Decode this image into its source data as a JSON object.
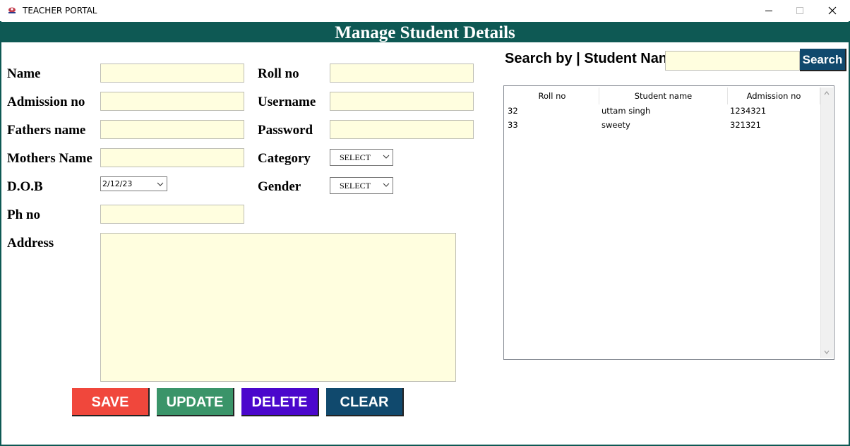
{
  "window": {
    "title": "TEACHER PORTAL"
  },
  "header": {
    "title": "Manage Student Details"
  },
  "form": {
    "name_label": "Name",
    "admission_label": "Admission no",
    "fathers_label": "Fathers name",
    "mothers_label": "Mothers Name",
    "dob_label": "D.O.B",
    "phone_label": "Ph no",
    "address_label": "Address",
    "roll_label": "Roll no",
    "username_label": "Username",
    "password_label": "Password",
    "category_label": "Category",
    "gender_label": "Gender",
    "dob_value": "2/12/23",
    "category_value": "SELECT",
    "gender_value": "SELECT"
  },
  "buttons": {
    "save": "SAVE",
    "update": "UPDATE",
    "delete": "DELETE",
    "clear": "CLEAR"
  },
  "colors": {
    "header": "#0e5954",
    "save": "#f0473c",
    "update": "#3a9469",
    "delete": "#4b07cc",
    "clear": "#10496d",
    "field": "#fffedf"
  },
  "search": {
    "label": "Search by | Student Nan",
    "button": "Search"
  },
  "table": {
    "columns": [
      "Roll no",
      "Student name",
      "Admission no"
    ],
    "rows": [
      {
        "roll": "32",
        "name": "uttam singh",
        "admission": "1234321"
      },
      {
        "roll": "33",
        "name": "sweety",
        "admission": "321321"
      }
    ]
  }
}
